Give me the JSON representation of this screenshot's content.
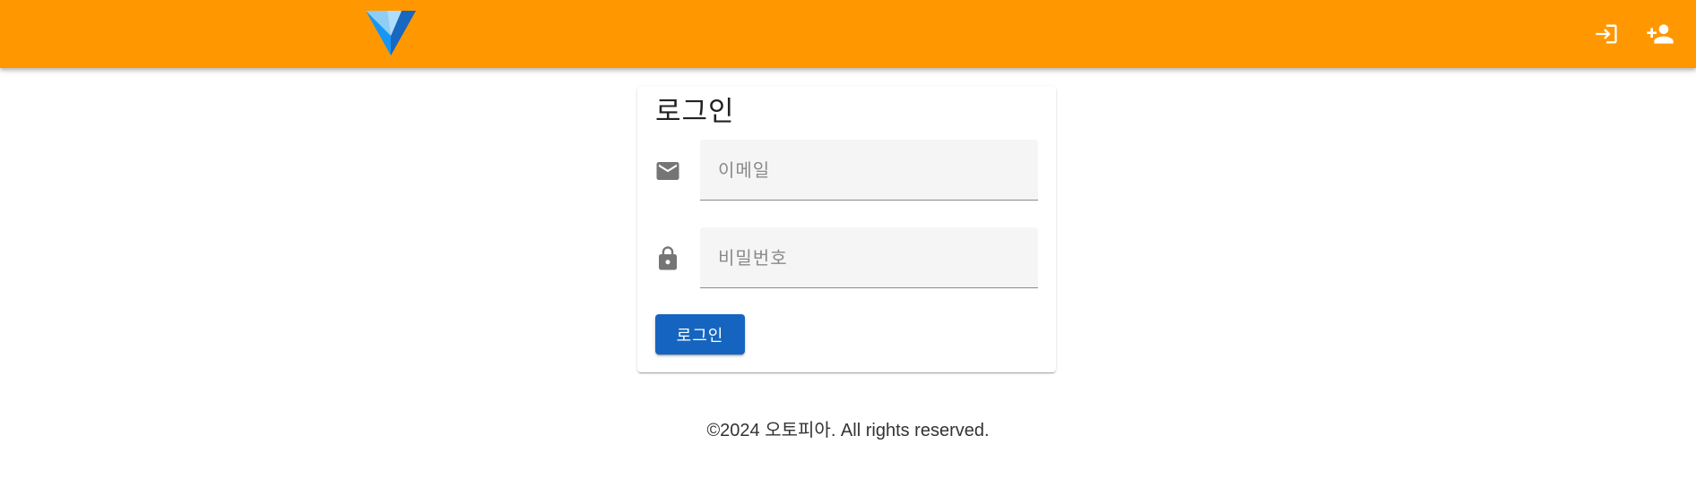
{
  "app_bar": {
    "logo_icon": "vuetify-logo-icon",
    "actions": [
      {
        "icon": "login-icon"
      },
      {
        "icon": "person-add-icon"
      }
    ]
  },
  "login_card": {
    "title": "로그인",
    "email": {
      "icon": "email-icon",
      "placeholder": "이메일",
      "value": ""
    },
    "password": {
      "icon": "lock-icon",
      "placeholder": "비밀번호",
      "value": ""
    },
    "submit_label": "로그인"
  },
  "footer": {
    "text": "©2024 오토피아. All rights reserved."
  },
  "colors": {
    "app_bar": "#ff9800",
    "primary_button": "#1565c0",
    "field_background": "#f5f5f5",
    "icon_gray": "#757575"
  }
}
